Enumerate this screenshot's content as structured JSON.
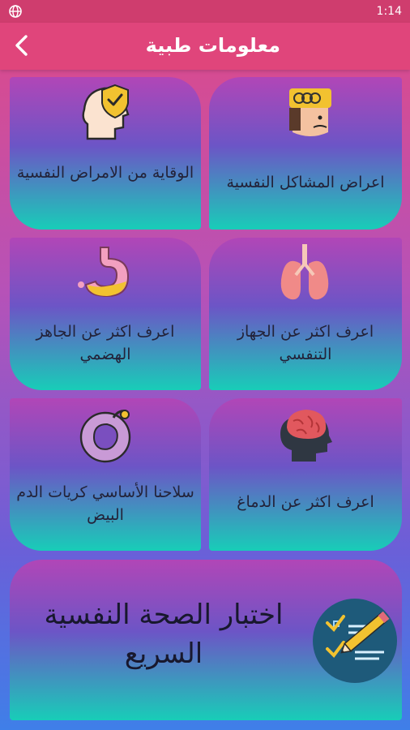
{
  "status": {
    "time": "1:14"
  },
  "app_bar": {
    "title": "معلومات طبية"
  },
  "cards": [
    {
      "label": "اعراض المشاكل النفسية",
      "icon": "head-headache-icon"
    },
    {
      "label": "الوقاية من الامراض النفسية",
      "icon": "head-shield-icon"
    },
    {
      "label": "اعرف اكثر عن الجهاز التنفسي",
      "icon": "lungs-icon"
    },
    {
      "label": "اعرف اكثر عن الجاهز الهضمي",
      "icon": "stomach-icon"
    },
    {
      "label": "اعرف اكثر عن الدماغ",
      "icon": "brain-icon"
    },
    {
      "label": "سلاحنا الأساسي كريات الدم البيض",
      "icon": "white-blood-cell-icon"
    }
  ],
  "quiz": {
    "label": "اختبار الصحة النفسية السريع",
    "icon": "checklist-pencil-icon"
  }
}
